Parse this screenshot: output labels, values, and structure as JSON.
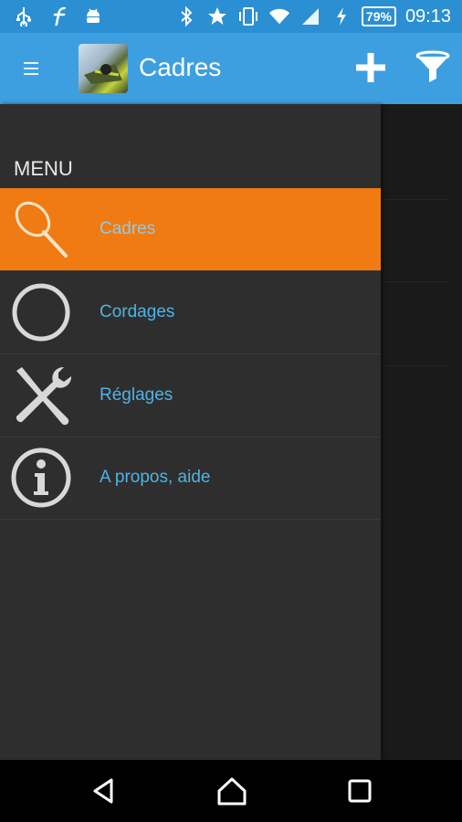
{
  "status_bar": {
    "battery_level": "79%",
    "time": "09:13",
    "left_icons": [
      "usb-icon",
      "facebook-icon",
      "android-icon"
    ],
    "right_icons": [
      "bluetooth-icon",
      "star-icon",
      "vibrate-icon",
      "wifi-icon",
      "signal-icon",
      "charging-icon",
      "battery-icon"
    ]
  },
  "action_bar": {
    "title": "Cadres",
    "actions": [
      "add-icon",
      "filter-icon"
    ]
  },
  "drawer": {
    "header": "MENU",
    "items": [
      {
        "label": "Cadres",
        "icon": "racket-icon",
        "active": true
      },
      {
        "label": "Cordages",
        "icon": "string-ring-icon",
        "active": false
      },
      {
        "label": "Réglages",
        "icon": "tools-icon",
        "active": false
      },
      {
        "label": "A propos, aide",
        "icon": "info-icon",
        "active": false
      }
    ]
  },
  "nav_bar": {
    "buttons": [
      "back-icon",
      "home-icon",
      "recents-icon"
    ]
  },
  "colors": {
    "status_bar": "#2a8fd3",
    "action_bar": "#3e9fe0",
    "drawer_bg": "#2e2e2e",
    "active_item": "#f07b12",
    "item_text": "#4fb3e6"
  }
}
